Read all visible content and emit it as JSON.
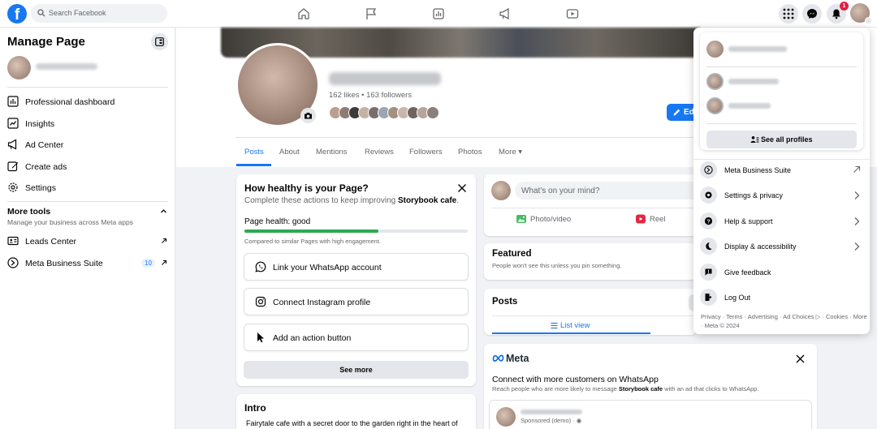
{
  "topbar": {
    "logo": "f",
    "search_placeholder": "Search Facebook",
    "notification_count": "1",
    "nav_icons": [
      "home-icon",
      "flag-icon",
      "chart-icon",
      "megaphone-icon",
      "video-icon"
    ]
  },
  "sidebar": {
    "title": "Manage Page",
    "items": [
      {
        "label": "Professional dashboard",
        "icon": "dashboard-icon"
      },
      {
        "label": "Insights",
        "icon": "insights-icon"
      },
      {
        "label": "Ad Center",
        "icon": "megaphone-icon"
      },
      {
        "label": "Create ads",
        "icon": "pencil-icon"
      },
      {
        "label": "Settings",
        "icon": "gear-icon"
      }
    ],
    "more_tools": {
      "title": "More tools",
      "subtitle": "Manage your business across Meta apps",
      "items": [
        {
          "label": "Leads Center",
          "icon": "contact-card-icon"
        },
        {
          "label": "Meta Business Suite",
          "icon": "business-suite-icon",
          "badge": "10"
        }
      ]
    }
  },
  "profile": {
    "stats": "162 likes • 163 followers",
    "edit_label": "Edit",
    "tabs": [
      "Posts",
      "About",
      "Mentions",
      "Reviews",
      "Followers",
      "Photos",
      "More ▾"
    ]
  },
  "health": {
    "title": "How healthy is your Page?",
    "subtitle_prefix": "Complete these actions to keep improving ",
    "subtitle_page": "Storybook cafe",
    "subtitle_suffix": ".",
    "health_label": "Page health: good",
    "progress": 0.6,
    "compare_text": "Compared to similar Pages with high engagement.",
    "actions": [
      {
        "label": "Link your WhatsApp account",
        "icon": "whatsapp-icon"
      },
      {
        "label": "Connect Instagram profile",
        "icon": "instagram-icon"
      },
      {
        "label": "Add an action button",
        "icon": "cursor-icon"
      }
    ],
    "see_more": "See more"
  },
  "intro": {
    "title": "Intro",
    "text": "Fairytale cafe with a secret door to the garden right in the heart of"
  },
  "composer": {
    "placeholder": "What's on your mind?",
    "photo_video": "Photo/video",
    "reel": "Reel"
  },
  "featured": {
    "title": "Featured",
    "subtitle": "People won't see this unless you pin something."
  },
  "posts": {
    "title": "Posts",
    "list_view": "List view"
  },
  "meta_ad": {
    "brand": "Meta",
    "title": "Connect with more customers on WhatsApp",
    "desc_prefix": "Reach people who are more likely to message ",
    "desc_page": "Storybook cafe",
    "desc_suffix": " with an ad that clicks to WhatsApp.",
    "sponsored": "Sponsored (demo) · ◉"
  },
  "dropdown": {
    "see_all_profiles": "See all profiles",
    "items": [
      {
        "label": "Meta Business Suite",
        "icon": "business-suite-icon",
        "trail": "external"
      },
      {
        "label": "Settings & privacy",
        "icon": "gear-icon",
        "trail": "chevron"
      },
      {
        "label": "Help & support",
        "icon": "help-icon",
        "trail": "chevron"
      },
      {
        "label": "Display & accessibility",
        "icon": "moon-icon",
        "trail": "chevron"
      },
      {
        "label": "Give feedback",
        "icon": "feedback-icon",
        "trail": ""
      },
      {
        "label": "Log Out",
        "icon": "logout-icon",
        "trail": ""
      }
    ],
    "footer": "Privacy · Terms · Advertising · Ad Choices ▷ · Cookies · More · Meta © 2024"
  },
  "colors": {
    "brand": "#1877f2",
    "health_good": "#2fa84f",
    "notification": "#e41e3f"
  }
}
